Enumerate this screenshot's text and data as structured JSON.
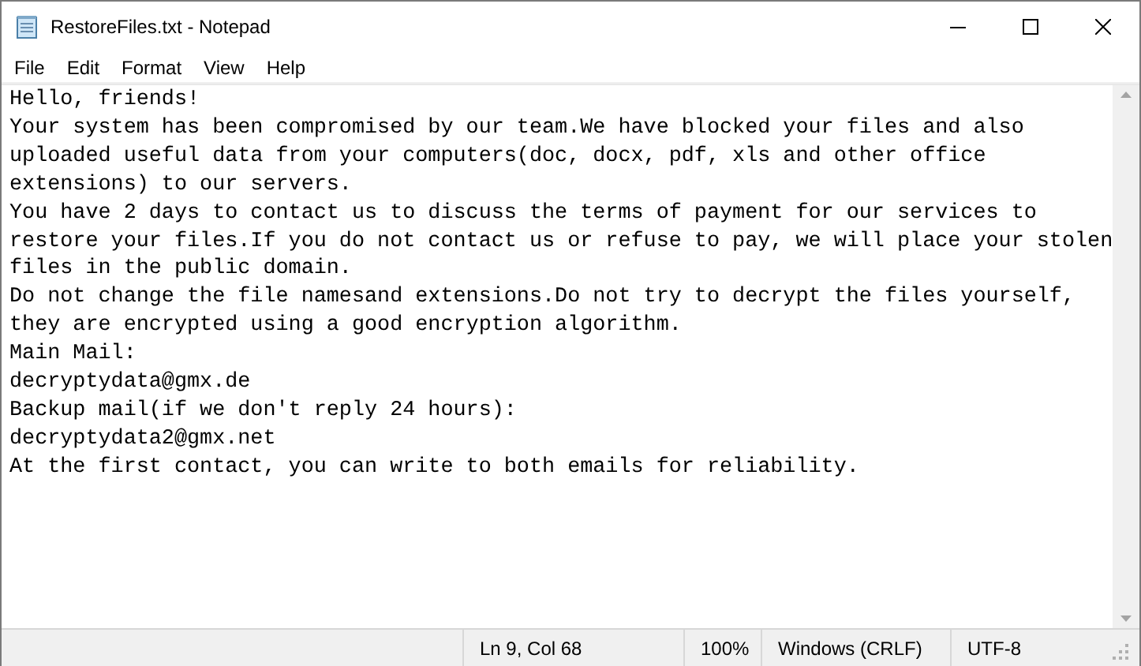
{
  "window": {
    "title": "RestoreFiles.txt - Notepad"
  },
  "menu": [
    "File",
    "Edit",
    "Format",
    "View",
    "Help"
  ],
  "editor": {
    "lines": [
      "Hello, friends!",
      "Your system has been compromised by our team.We have blocked your files and also",
      "uploaded useful data from your computers(doc, docx, pdf, xls and other office",
      "extensions) to our servers.",
      "You have 2 days to contact us to discuss the terms of payment for our services to",
      "restore your files.If you do not contact us or refuse to pay, we will place your stolen",
      "files in the public domain.",
      "Do not change the file namesand extensions.Do not try to decrypt the files yourself,",
      "they are encrypted using a good encryption algorithm.",
      "Main Mail:",
      "decryptydata@gmx.de",
      "Backup mail(if we don't reply 24 hours):",
      "decryptydata2@gmx.net",
      "At the first contact, you can write to both emails for reliability."
    ]
  },
  "status_bar": {
    "position": "Ln 9, Col 68",
    "zoom": "100%",
    "line_ending": "Windows (CRLF)",
    "encoding": "UTF-8"
  }
}
